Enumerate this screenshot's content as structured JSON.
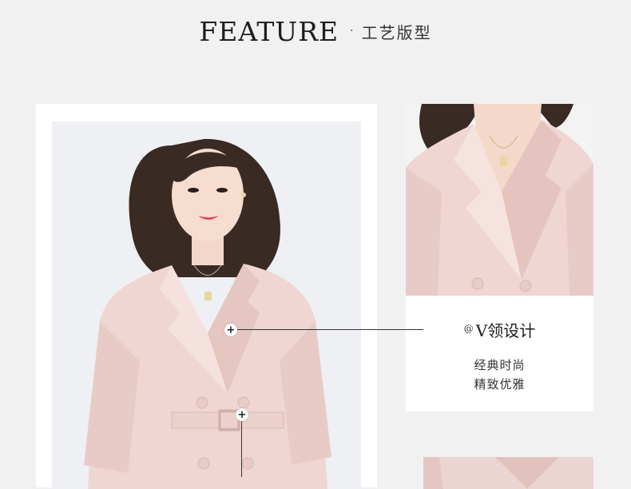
{
  "header": {
    "title": "FEATURE",
    "separator": "·",
    "subtitle": "工艺版型"
  },
  "detail": {
    "marker": "@",
    "title": "V领设计",
    "line1": "经典时尚",
    "line2": "精致优雅"
  },
  "callouts": {
    "marker_symbol": "+"
  },
  "colors": {
    "background": "#f1f1f1",
    "card": "#ffffff",
    "blazer_pink": "#efd6d3",
    "hair": "#3a2a24"
  }
}
